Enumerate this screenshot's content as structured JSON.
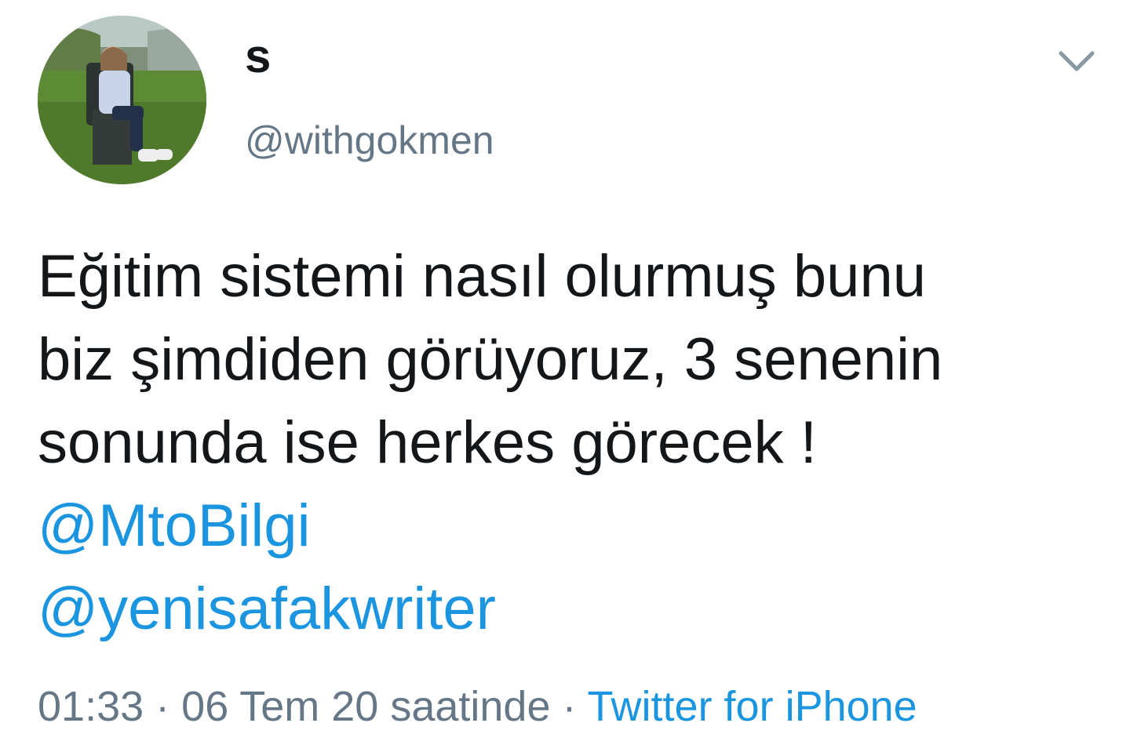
{
  "author": {
    "display_name": "s",
    "handle": "@withgokmen",
    "avatar_icon": "profile-photo"
  },
  "menu_icon": "chevron-down-icon",
  "tweet": {
    "lines": [
      "Eğitim sistemi nasıl olurmuş bunu",
      "biz şimdiden görüyoruz, 3 senenin",
      "sonunda ise herkes görecek !"
    ],
    "mentions": [
      "@MtoBilgi",
      "@yenisafakwriter"
    ]
  },
  "meta": {
    "time": "01:33",
    "separator": "·",
    "date": "06 Tem 20 saatinde",
    "source": "Twitter for iPhone"
  },
  "colors": {
    "text": "#14171a",
    "secondary": "#657786",
    "link": "#1b95e0"
  }
}
